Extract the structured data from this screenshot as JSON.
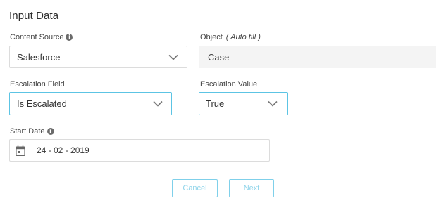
{
  "form": {
    "title": "Input Data",
    "content_source": {
      "label": "Content Source",
      "value": "Salesforce",
      "info_icon": "info-icon"
    },
    "object": {
      "label": "Object",
      "hint": "( Auto fill )",
      "value": "Case"
    },
    "escalation_field": {
      "label": "Escalation Field",
      "value": "Is Escalated"
    },
    "escalation_value": {
      "label": "Escalation Value",
      "value": "True"
    },
    "start_date": {
      "label": "Start Date",
      "value": "24 - 02 - 2019",
      "info_icon": "info-icon",
      "picker_icon": "calendar-icon"
    },
    "buttons": {
      "cancel": "Cancel",
      "next": "Next"
    }
  },
  "colors": {
    "focus_border": "#5cc4e4",
    "button_border": "#7fd0ea",
    "button_text": "#8fd4ea",
    "readonly_bg": "#f4f4f4"
  }
}
